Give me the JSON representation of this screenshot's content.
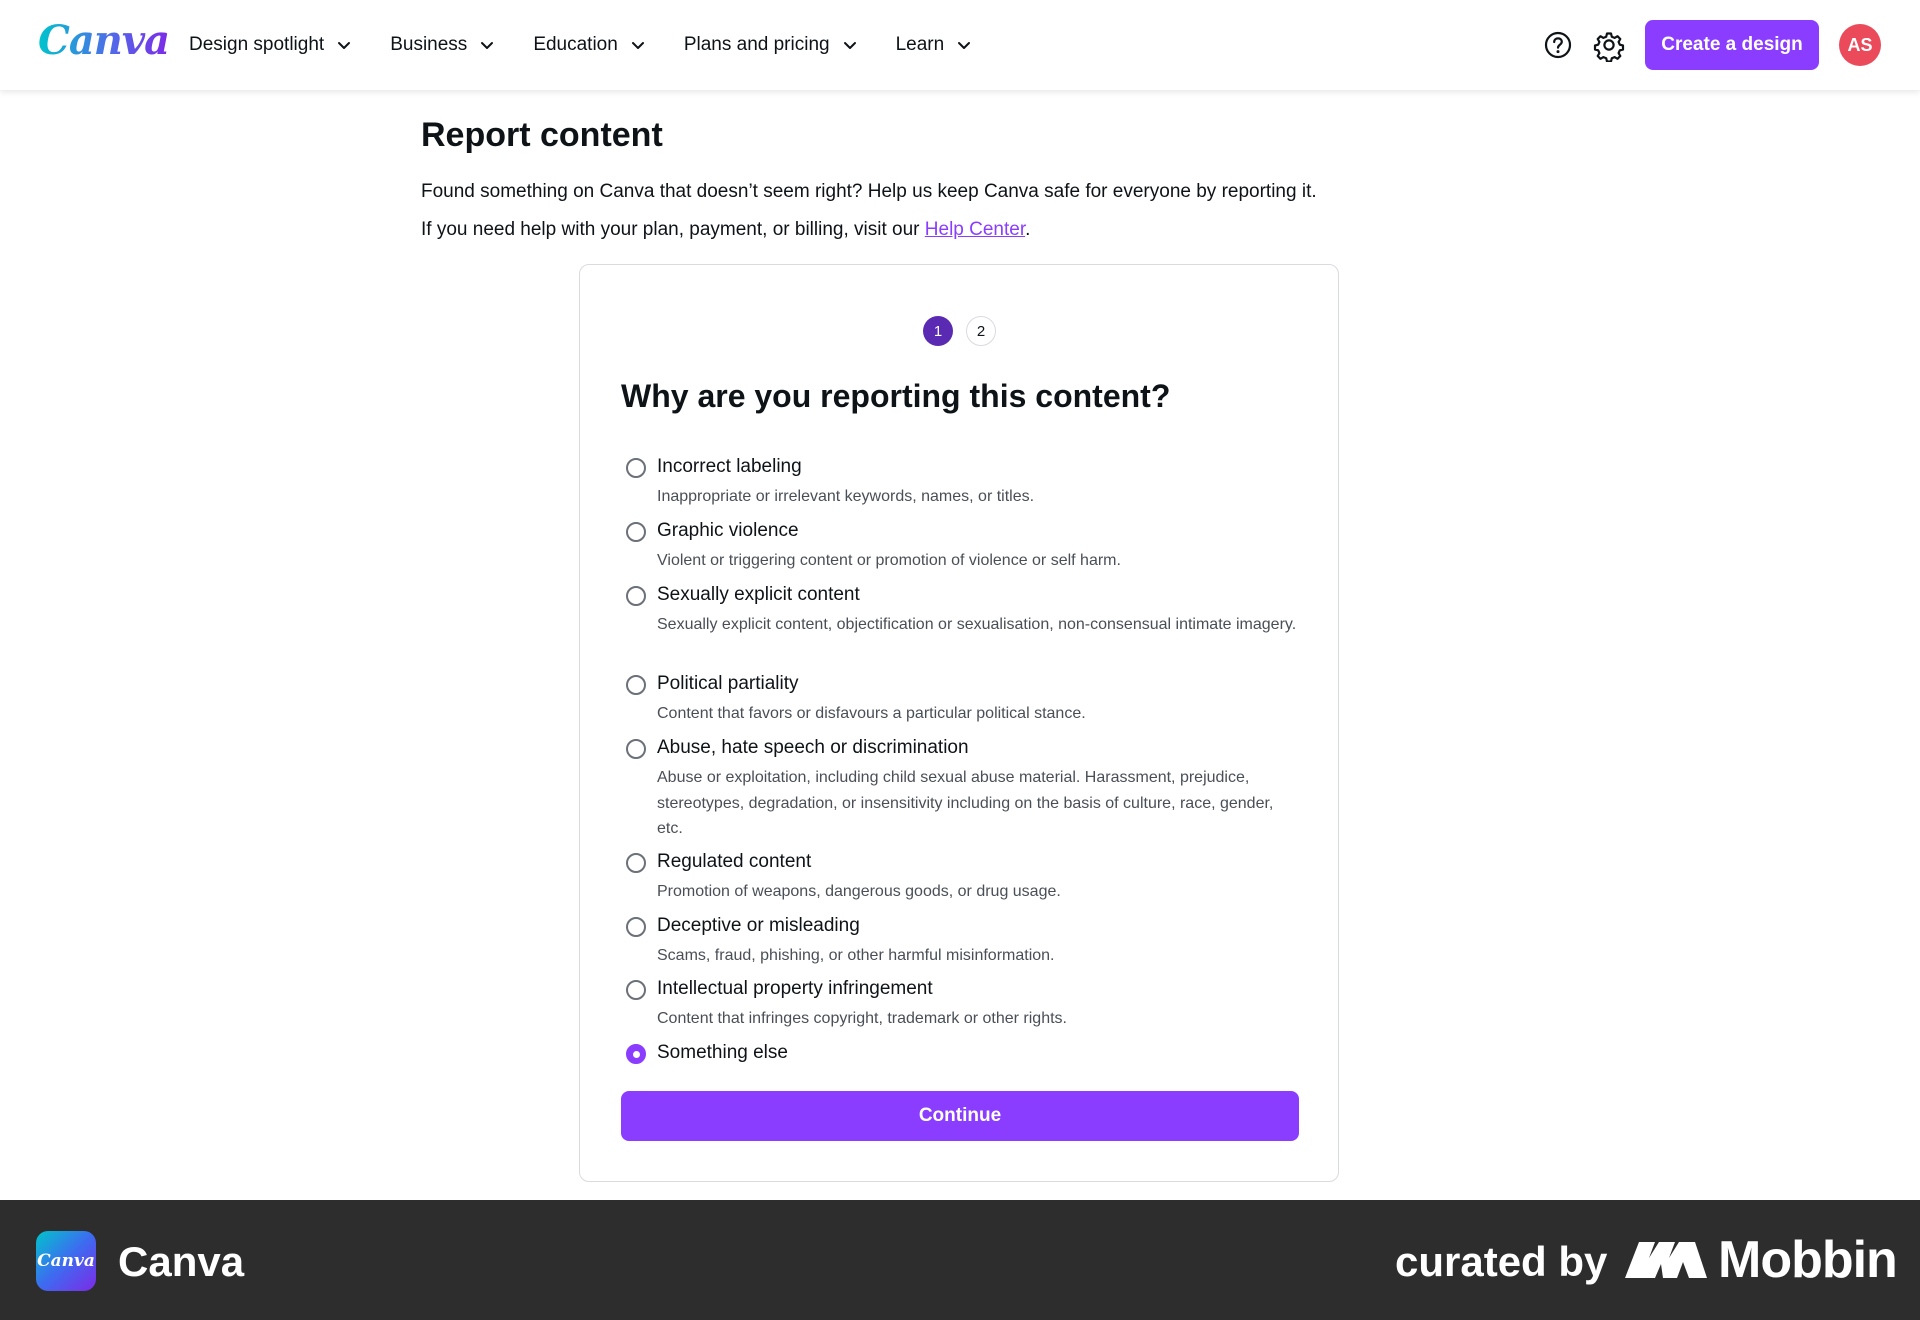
{
  "header": {
    "logo_text": "Canva",
    "nav": [
      {
        "label": "Design spotlight"
      },
      {
        "label": "Business"
      },
      {
        "label": "Education"
      },
      {
        "label": "Plans and pricing"
      },
      {
        "label": "Learn"
      }
    ],
    "help_icon": "question-circle-icon",
    "settings_icon": "gear-icon",
    "create_button": "Create a design",
    "avatar_initials": "AS"
  },
  "page": {
    "title": "Report content",
    "intro": "Found something on Canva that doesn’t seem right? Help us keep Canva safe for everyone by reporting it.",
    "help_prefix": "If you need help with your plan, payment, or billing, visit our ",
    "help_link": "Help Center",
    "help_suffix": "."
  },
  "form": {
    "steps": [
      "1",
      "2"
    ],
    "current_step": 1,
    "question": "Why are you reporting this content?",
    "options": [
      {
        "label": "Incorrect labeling",
        "description": "Inappropriate or irrelevant keywords, names, or titles.",
        "selected": false
      },
      {
        "label": "Graphic violence",
        "description": "Violent or triggering content or promotion of violence or self harm.",
        "selected": false
      },
      {
        "label": "Sexually explicit content",
        "description": "Sexually explicit content, objectification or sexualisation, non-consensual intimate imagery.",
        "selected": false
      },
      {
        "label": "Political partiality",
        "description": "Content that favors or disfavours a particular political stance.",
        "selected": false
      },
      {
        "label": "Abuse, hate speech or discrimination",
        "description": "Abuse or exploitation, including child sexual abuse material. Harassment, prejudice, stereotypes, degradation, or insensitivity including on the basis of culture, race, gender, etc.",
        "selected": false
      },
      {
        "label": "Regulated content",
        "description": "Promotion of weapons, dangerous goods, or drug usage.",
        "selected": false
      },
      {
        "label": "Deceptive or misleading",
        "description": "Scams, fraud, phishing, or other harmful misinformation.",
        "selected": false
      },
      {
        "label": "Intellectual property infringement",
        "description": "Content that infringes copyright, trademark or other rights.",
        "selected": false
      },
      {
        "label": "Something else",
        "description": "",
        "selected": true
      }
    ],
    "continue_button": "Continue"
  },
  "footer": {
    "app_icon_text": "Canva",
    "app_name": "Canva",
    "curated_by": "curated by",
    "brand": "Mobbin"
  },
  "colors": {
    "accent": "#8b3dff",
    "step_active": "#5b2ab2",
    "avatar": "#ea4a5a",
    "footer_bg": "#2d2d2e"
  }
}
